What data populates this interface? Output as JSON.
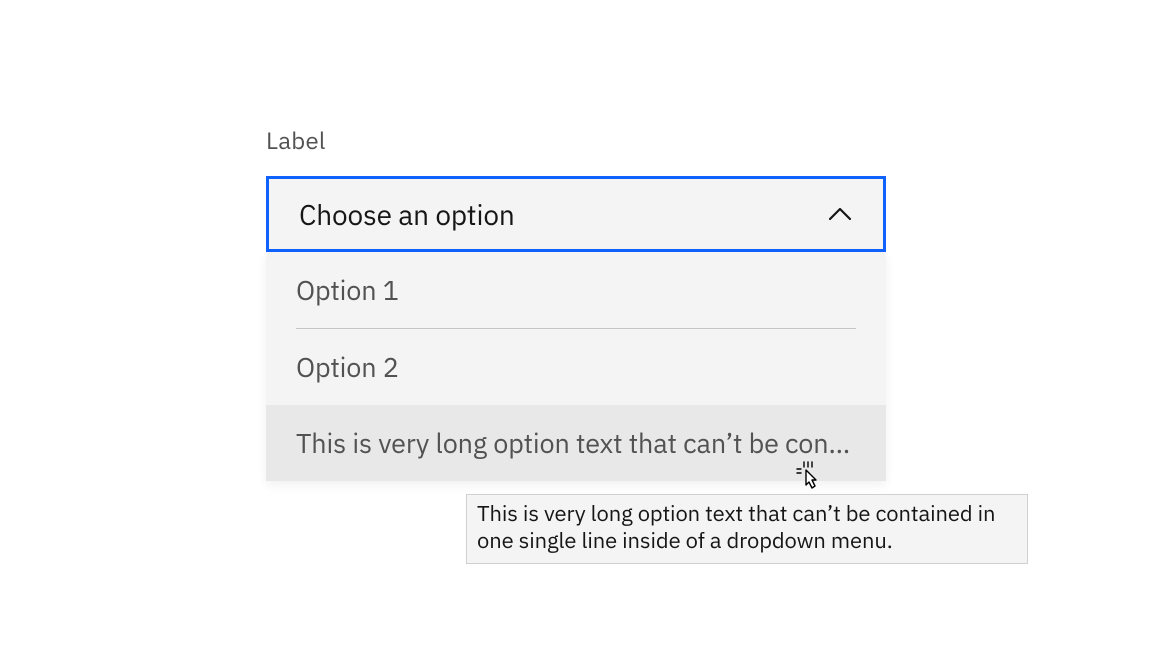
{
  "dropdown": {
    "label": "Label",
    "placeholder": "Choose an option",
    "options": {
      "0": {
        "label": "Option 1"
      },
      "1": {
        "label": "Option 2"
      },
      "2": {
        "label": "This is very long option text that can’t be contained in one single line inside of a dropdown menu."
      }
    }
  },
  "tooltip": {
    "text": "This is very long option text that can’t be contained in one single line inside of a dropdown menu."
  }
}
